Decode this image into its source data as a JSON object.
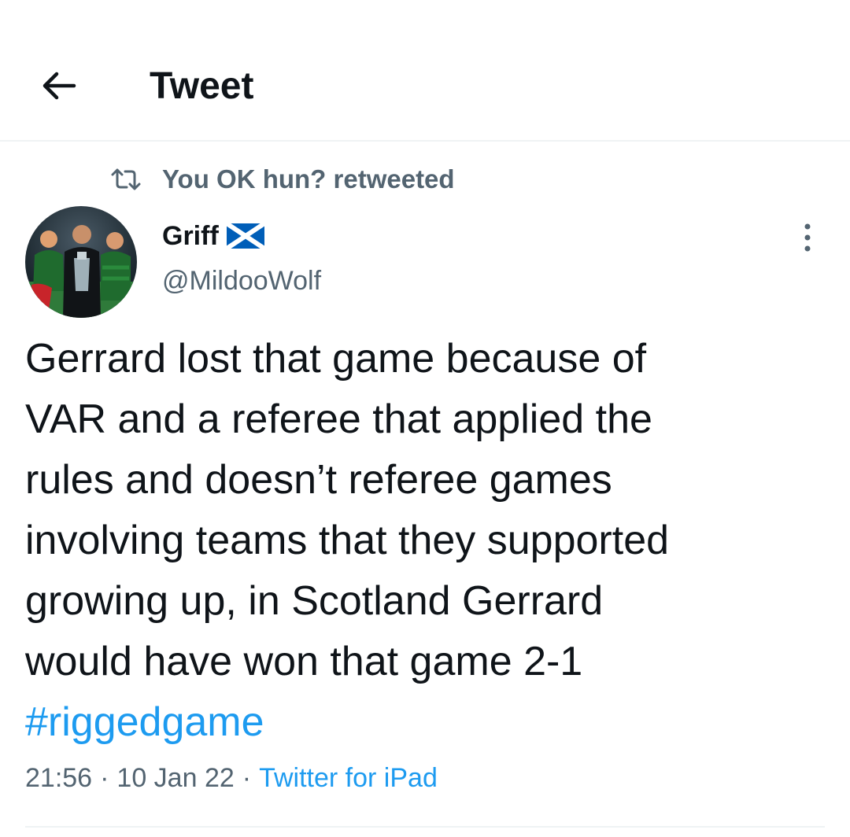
{
  "header": {
    "back_icon": "arrow-left-icon",
    "title": "Tweet"
  },
  "social_context": {
    "icon": "retweet-icon",
    "text": "You OK hun? retweeted"
  },
  "tweet": {
    "author": {
      "display_name": "Griff",
      "flag_icon": "scotland-flag-icon",
      "handle": "@MildooWolf"
    },
    "more_icon": "more-vertical-icon",
    "text": "Gerrard lost that game because of\nVAR and a referee that applied the\nrules and doesn’t referee games\ninvolving teams that they supported\ngrowing up, in Scotland Gerrard\nwould have won that game 2-1",
    "hashtag": "#riggedgame",
    "time": "21:56",
    "separator": "·",
    "date": "10 Jan 22",
    "source": "Twitter for iPad"
  },
  "colors": {
    "text_primary": "#0f1419",
    "text_secondary": "#536471",
    "link": "#1d9bf0",
    "divider": "#eff3f4",
    "flag_blue": "#005eb8"
  }
}
